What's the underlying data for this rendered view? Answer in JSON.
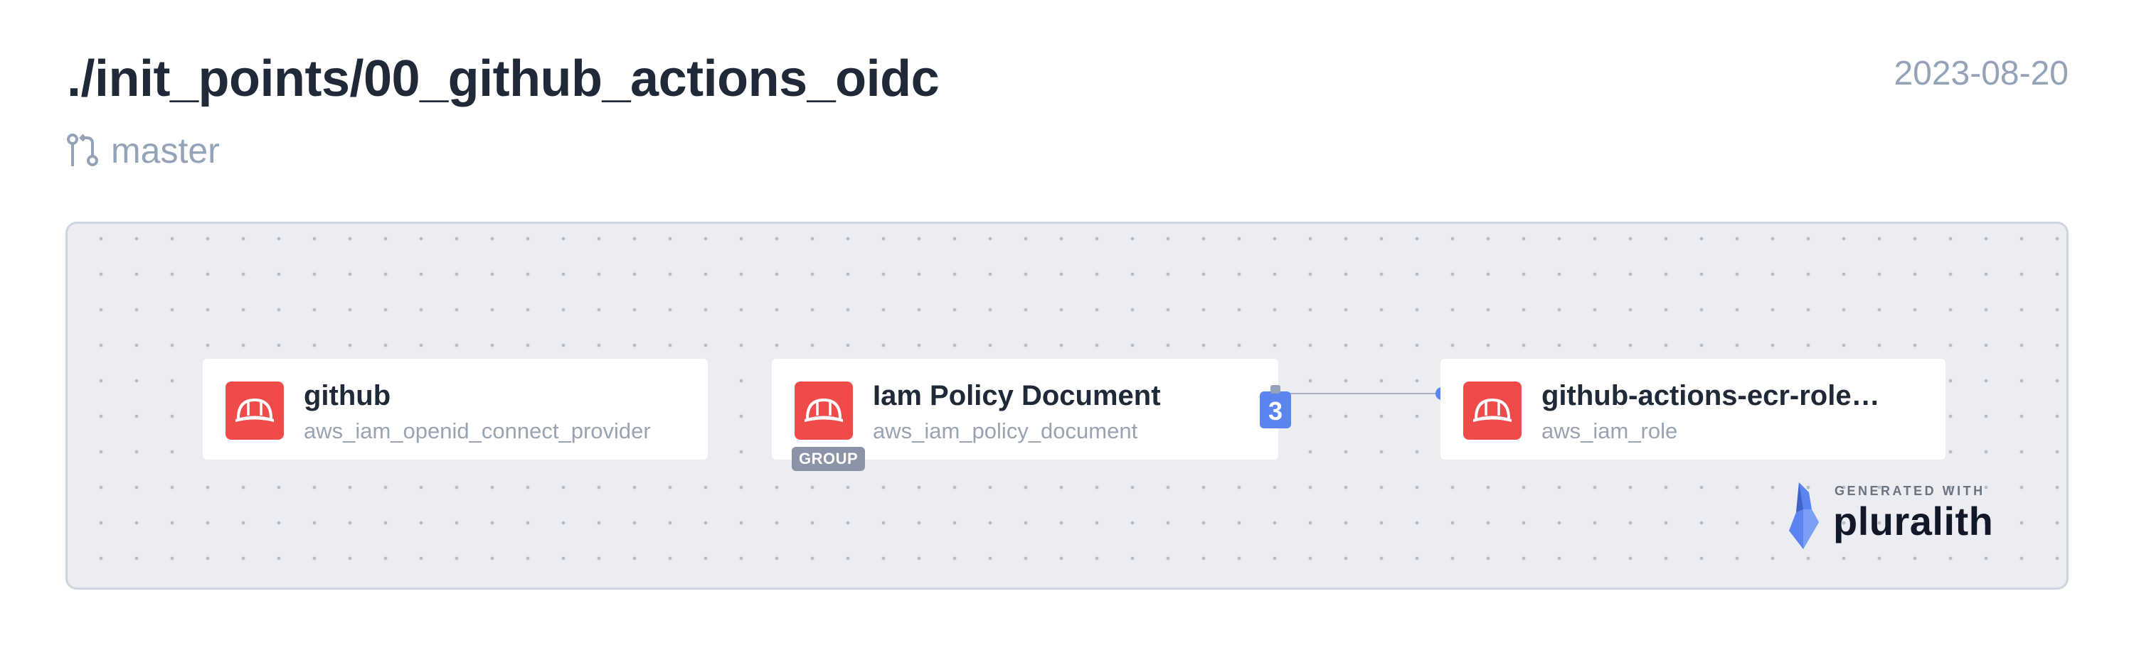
{
  "header": {
    "title": "./init_points/00_github_actions_oidc",
    "date": "2023-08-20",
    "branch": "master"
  },
  "diagram": {
    "nodes": [
      {
        "id": "github",
        "title": "github",
        "subtitle": "aws_iam_openid_connect_provider",
        "icon": "hardhat-icon"
      },
      {
        "id": "policy",
        "title": "Iam Policy Document",
        "subtitle": "aws_iam_policy_document",
        "icon": "hardhat-icon",
        "group_label": "GROUP",
        "count": "3"
      },
      {
        "id": "role",
        "title": "github-actions-ecr-role…",
        "subtitle": "aws_iam_role",
        "icon": "hardhat-icon"
      }
    ],
    "edges": [
      {
        "from": "policy",
        "to": "role"
      }
    ]
  },
  "branding": {
    "generated_with": "GENERATED WITH",
    "name": "pluralith"
  },
  "colors": {
    "node_icon": "#f04b4b",
    "count_badge": "#5b84f0",
    "canvas_bg": "#ecedf2",
    "edge_dot": "#5b84f0"
  }
}
